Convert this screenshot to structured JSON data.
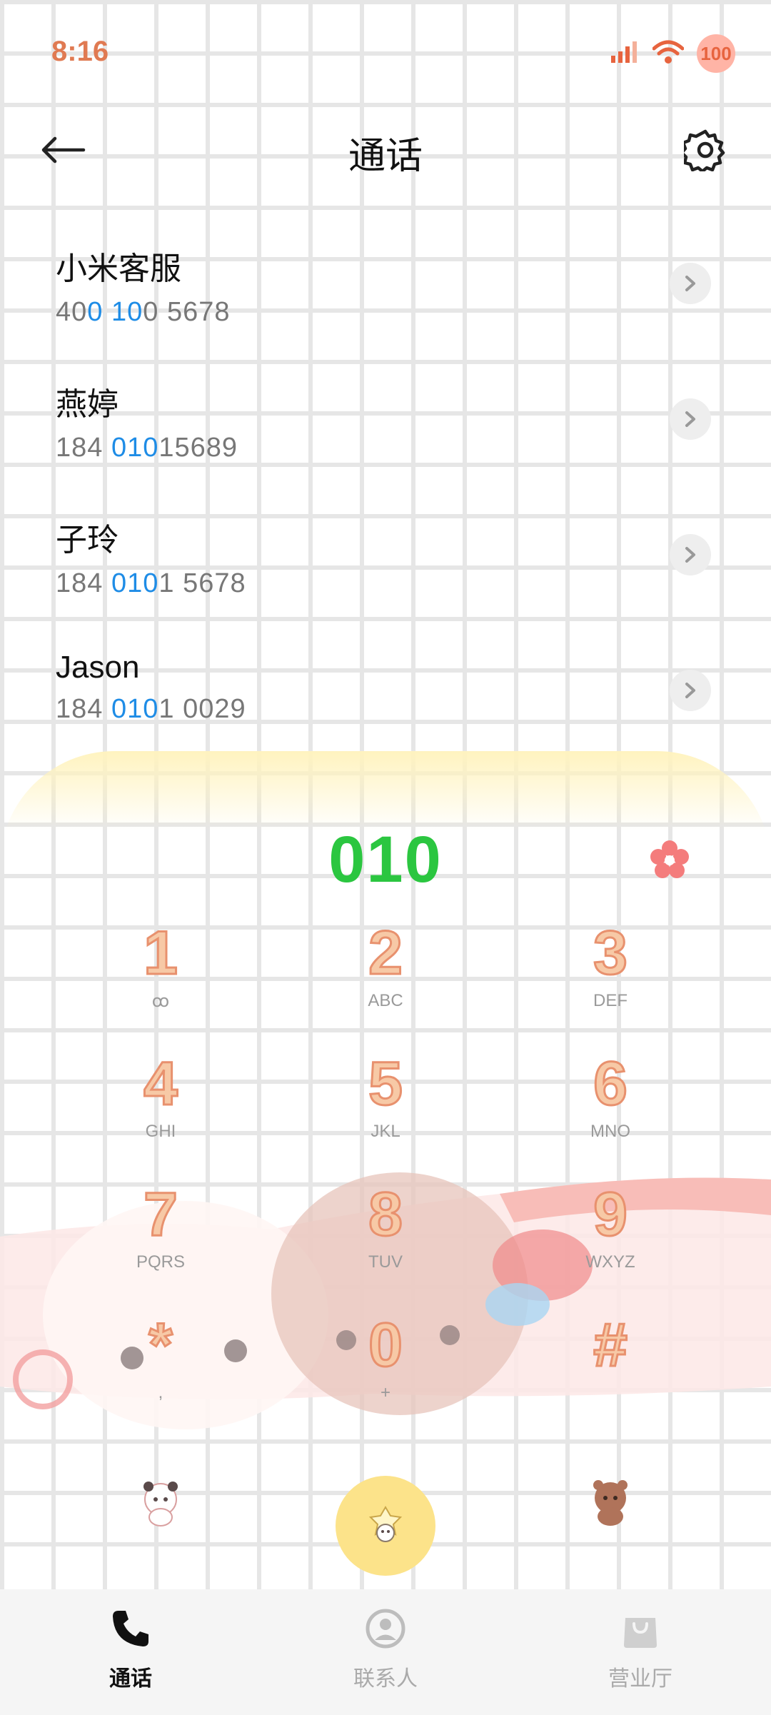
{
  "status_bar": {
    "time": "8:16",
    "battery": "100",
    "signal_icon": "signal-icon",
    "wifi_icon": "wifi-icon"
  },
  "header": {
    "title": "通话",
    "back_icon": "arrow-left-icon",
    "settings_icon": "gear-icon"
  },
  "contacts": [
    {
      "name": "小米客服",
      "number_parts": [
        {
          "t": "40"
        },
        {
          "t": "0",
          "hl": true
        },
        {
          "t": " "
        },
        {
          "t": "10",
          "hl": true
        },
        {
          "t": "0 5678"
        }
      ]
    },
    {
      "name": "燕婷",
      "number_parts": [
        {
          "t": "184 "
        },
        {
          "t": "010",
          "hl": true
        },
        {
          "t": "15689"
        }
      ]
    },
    {
      "name": "子玲",
      "number_parts": [
        {
          "t": "184 "
        },
        {
          "t": "010",
          "hl": true
        },
        {
          "t": "1 5678"
        }
      ]
    },
    {
      "name": "Jason",
      "number_parts": [
        {
          "t": "184 "
        },
        {
          "t": "010",
          "hl": true
        },
        {
          "t": "1 0029"
        }
      ]
    }
  ],
  "dialpad": {
    "entered_number": "010",
    "keys": [
      {
        "digit": "1",
        "letters": "ꝏ"
      },
      {
        "digit": "2",
        "letters": "ABC"
      },
      {
        "digit": "3",
        "letters": "DEF"
      },
      {
        "digit": "4",
        "letters": "GHI"
      },
      {
        "digit": "5",
        "letters": "JKL"
      },
      {
        "digit": "6",
        "letters": "MNO"
      },
      {
        "digit": "7",
        "letters": "PQRS"
      },
      {
        "digit": "8",
        "letters": "TUV"
      },
      {
        "digit": "9",
        "letters": "WXYZ"
      },
      {
        "digit": "*",
        "letters": ","
      },
      {
        "digit": "0",
        "letters": "+"
      },
      {
        "digit": "#",
        "letters": ""
      }
    ]
  },
  "bottom_nav": {
    "items": [
      {
        "label": "通话",
        "icon": "phone-icon",
        "active": true
      },
      {
        "label": "联系人",
        "icon": "contacts-icon",
        "active": false
      },
      {
        "label": "营业厅",
        "icon": "shop-bag-icon",
        "active": false
      }
    ]
  },
  "colors": {
    "accent_green": "#2bc640",
    "highlight_blue": "#1e8ce6",
    "time_orange": "#e07a52",
    "call_yellow": "#fce38a"
  }
}
